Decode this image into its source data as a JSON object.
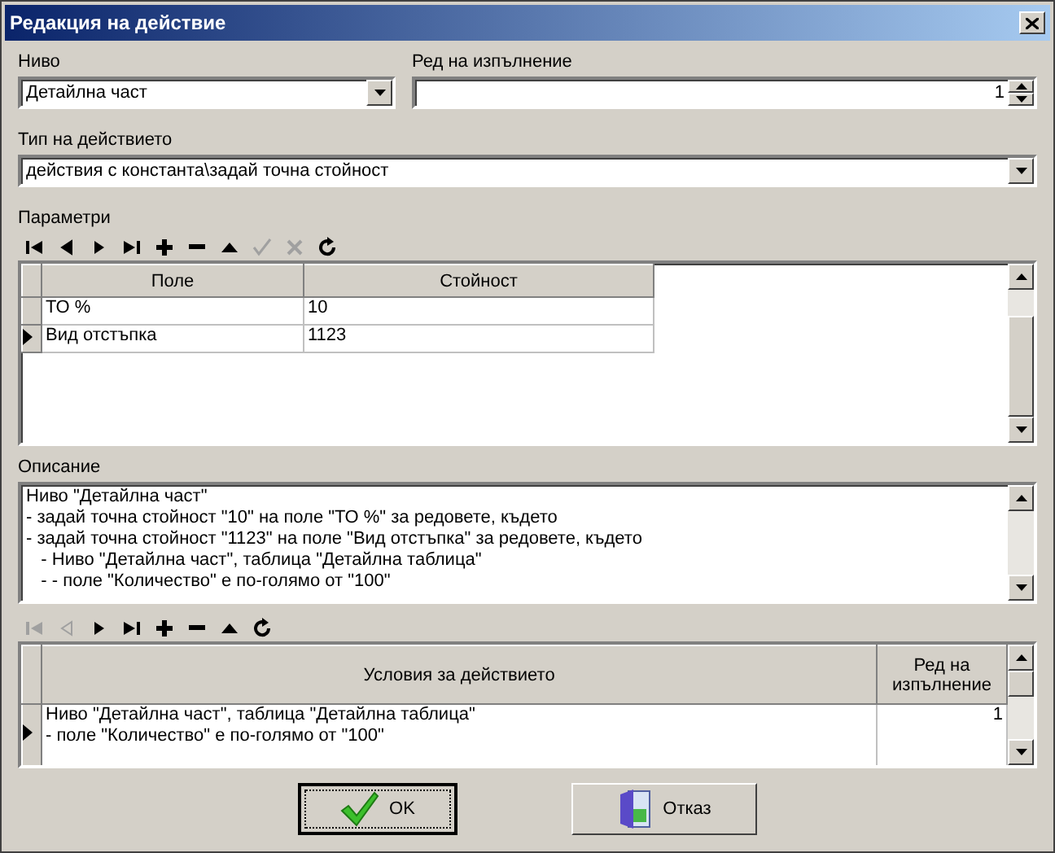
{
  "window": {
    "title": "Редакция на действие"
  },
  "level_field": {
    "label": "Ниво",
    "value": "Детайлна част"
  },
  "order_field": {
    "label": "Ред на изпълнение",
    "value": "1"
  },
  "action_type": {
    "label": "Тип на действието",
    "value": "действия с константа\\задай точна стойност"
  },
  "parameters": {
    "label": "Параметри",
    "toolbar": [
      {
        "kind": "first",
        "disabled": false
      },
      {
        "kind": "prev",
        "disabled": false
      },
      {
        "kind": "next",
        "disabled": false
      },
      {
        "kind": "last",
        "disabled": false
      },
      {
        "kind": "add",
        "disabled": false
      },
      {
        "kind": "remove",
        "disabled": false
      },
      {
        "kind": "up",
        "disabled": false
      },
      {
        "kind": "confirm",
        "disabled": true
      },
      {
        "kind": "cancel",
        "disabled": true
      },
      {
        "kind": "refresh",
        "disabled": false
      }
    ],
    "columns": [
      "Поле",
      "Стойност"
    ],
    "rows": [
      {
        "cells": [
          "ТО %",
          "10"
        ],
        "selected": false
      },
      {
        "cells": [
          "Вид отстъпка",
          "1123"
        ],
        "selected": true
      }
    ]
  },
  "description": {
    "label": "Описание",
    "lines": [
      "Ниво \"Детайлна част\"",
      "- задай точна стойност \"10\" на поле \"ТО %\" за редовете, където",
      "- задай точна стойност \"1123\" на поле \"Вид отстъпка\" за редовете, където",
      "   - Ниво \"Детайлна част\", таблица \"Детайлна таблица\"",
      "   - - поле \"Количество\" е по-голямо от \"100\""
    ]
  },
  "conditions": {
    "toolbar": [
      {
        "kind": "first",
        "disabled": true
      },
      {
        "kind": "prev",
        "disabled": true
      },
      {
        "kind": "next",
        "disabled": false
      },
      {
        "kind": "last",
        "disabled": false
      },
      {
        "kind": "add",
        "disabled": false
      },
      {
        "kind": "remove",
        "disabled": false
      },
      {
        "kind": "up",
        "disabled": false
      },
      {
        "kind": "refresh",
        "disabled": false
      }
    ],
    "columns": [
      "Условия за действието",
      "Ред на изпълнение"
    ],
    "rows": [
      {
        "lines": [
          "Ниво \"Детайлна част\", таблица \"Детайлна таблица\"",
          "- поле \"Количество\" е по-голямо от \"100\""
        ],
        "order": "1",
        "selected": true
      }
    ]
  },
  "buttons": [
    {
      "kind": "ok",
      "label": "OK"
    },
    {
      "kind": "cancel",
      "label": "Отказ"
    }
  ]
}
